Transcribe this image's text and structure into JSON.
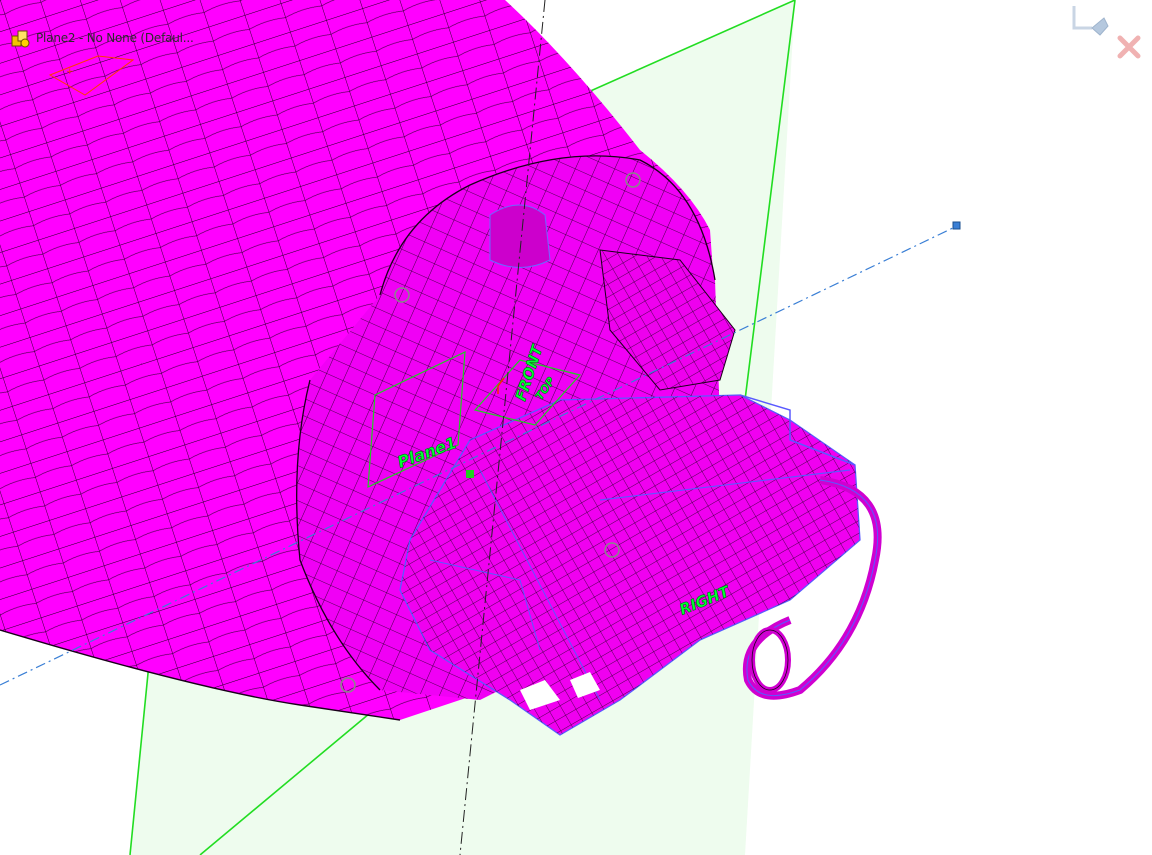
{
  "feature_tree_flyout": {
    "item_label": "Plane2 - No None (Defaul...",
    "item_icon": "part-icon"
  },
  "confirmation_corner": {
    "ok_icon": "accept-arrow-icon",
    "cancel_icon": "cancel-x-icon"
  },
  "plane_labels": {
    "plane1": "Plane1",
    "front": "FRONT",
    "top": "TOP",
    "right": "RIGHT"
  },
  "colors": {
    "model_surface": "#ff00ff",
    "mesh_lines": "#1a001a",
    "edges_highlight": "#6a6aff",
    "plane_border": "#22dd22",
    "plane_fill": "#e9fbe9",
    "axis_line": "#3a7fd5",
    "sketch_origin": "#ff3b00"
  }
}
